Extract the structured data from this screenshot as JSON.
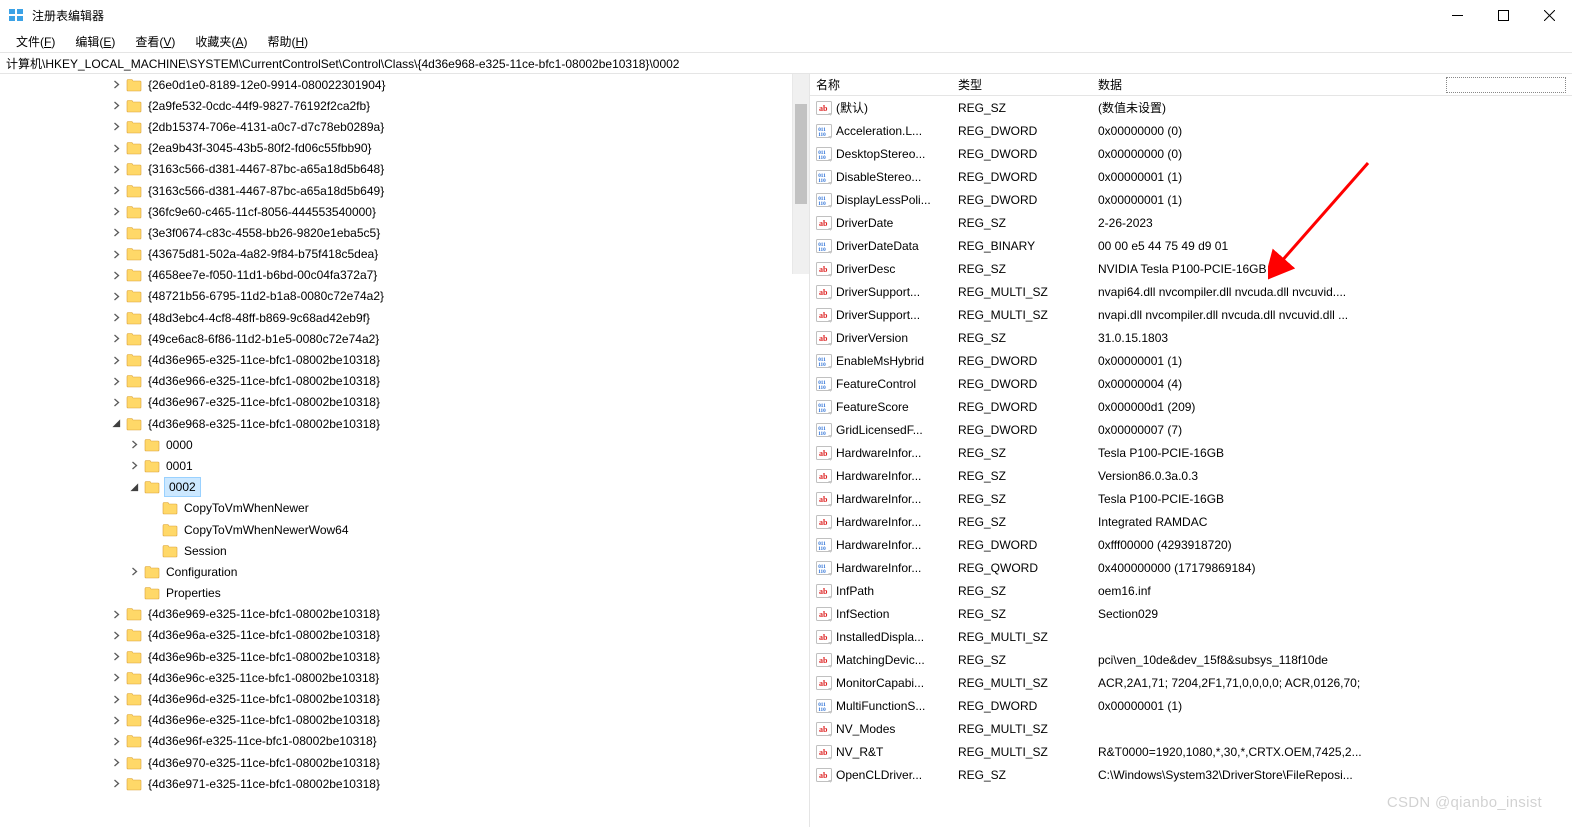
{
  "window": {
    "title": "注册表编辑器"
  },
  "menu": {
    "file": "文件",
    "file_key": "F",
    "edit": "编辑",
    "edit_key": "E",
    "view": "查看",
    "view_key": "V",
    "favorites": "收藏夹",
    "favorites_key": "A",
    "help": "帮助",
    "help_key": "H"
  },
  "address": {
    "path": "计算机\\HKEY_LOCAL_MACHINE\\SYSTEM\\CurrentControlSet\\Control\\Class\\{4d36e968-e325-11ce-bfc1-08002be10318}\\0002"
  },
  "tree": [
    {
      "depth": 0,
      "expander": "closed",
      "label": "{26e0d1e0-8189-12e0-9914-080022301904}"
    },
    {
      "depth": 0,
      "expander": "closed",
      "label": "{2a9fe532-0cdc-44f9-9827-76192f2ca2fb}"
    },
    {
      "depth": 0,
      "expander": "closed",
      "label": "{2db15374-706e-4131-a0c7-d7c78eb0289a}"
    },
    {
      "depth": 0,
      "expander": "closed",
      "label": "{2ea9b43f-3045-43b5-80f2-fd06c55fbb90}"
    },
    {
      "depth": 0,
      "expander": "closed",
      "label": "{3163c566-d381-4467-87bc-a65a18d5b648}"
    },
    {
      "depth": 0,
      "expander": "closed",
      "label": "{3163c566-d381-4467-87bc-a65a18d5b649}"
    },
    {
      "depth": 0,
      "expander": "closed",
      "label": "{36fc9e60-c465-11cf-8056-444553540000}"
    },
    {
      "depth": 0,
      "expander": "closed",
      "label": "{3e3f0674-c83c-4558-bb26-9820e1eba5c5}"
    },
    {
      "depth": 0,
      "expander": "closed",
      "label": "{43675d81-502a-4a82-9f84-b75f418c5dea}"
    },
    {
      "depth": 0,
      "expander": "closed",
      "label": "{4658ee7e-f050-11d1-b6bd-00c04fa372a7}"
    },
    {
      "depth": 0,
      "expander": "closed",
      "label": "{48721b56-6795-11d2-b1a8-0080c72e74a2}"
    },
    {
      "depth": 0,
      "expander": "closed",
      "label": "{48d3ebc4-4cf8-48ff-b869-9c68ad42eb9f}"
    },
    {
      "depth": 0,
      "expander": "closed",
      "label": "{49ce6ac8-6f86-11d2-b1e5-0080c72e74a2}"
    },
    {
      "depth": 0,
      "expander": "closed",
      "label": "{4d36e965-e325-11ce-bfc1-08002be10318}"
    },
    {
      "depth": 0,
      "expander": "closed",
      "label": "{4d36e966-e325-11ce-bfc1-08002be10318}"
    },
    {
      "depth": 0,
      "expander": "closed",
      "label": "{4d36e967-e325-11ce-bfc1-08002be10318}"
    },
    {
      "depth": 0,
      "expander": "open",
      "label": "{4d36e968-e325-11ce-bfc1-08002be10318}"
    },
    {
      "depth": 1,
      "expander": "closed",
      "label": "0000"
    },
    {
      "depth": 1,
      "expander": "closed",
      "label": "0001"
    },
    {
      "depth": 1,
      "expander": "open",
      "label": "0002",
      "selected": true
    },
    {
      "depth": 2,
      "expander": "none",
      "label": "CopyToVmWhenNewer"
    },
    {
      "depth": 2,
      "expander": "none",
      "label": "CopyToVmWhenNewerWow64"
    },
    {
      "depth": 2,
      "expander": "none",
      "label": "Session"
    },
    {
      "depth": 1,
      "expander": "closed",
      "label": "Configuration"
    },
    {
      "depth": 1,
      "expander": "none",
      "label": "Properties"
    },
    {
      "depth": 0,
      "expander": "closed",
      "label": "{4d36e969-e325-11ce-bfc1-08002be10318}"
    },
    {
      "depth": 0,
      "expander": "closed",
      "label": "{4d36e96a-e325-11ce-bfc1-08002be10318}"
    },
    {
      "depth": 0,
      "expander": "closed",
      "label": "{4d36e96b-e325-11ce-bfc1-08002be10318}"
    },
    {
      "depth": 0,
      "expander": "closed",
      "label": "{4d36e96c-e325-11ce-bfc1-08002be10318}"
    },
    {
      "depth": 0,
      "expander": "closed",
      "label": "{4d36e96d-e325-11ce-bfc1-08002be10318}"
    },
    {
      "depth": 0,
      "expander": "closed",
      "label": "{4d36e96e-e325-11ce-bfc1-08002be10318}"
    },
    {
      "depth": 0,
      "expander": "closed",
      "label": "{4d36e96f-e325-11ce-bfc1-08002be10318}"
    },
    {
      "depth": 0,
      "expander": "closed",
      "label": "{4d36e970-e325-11ce-bfc1-08002be10318}"
    },
    {
      "depth": 0,
      "expander": "closed",
      "label": "{4d36e971-e325-11ce-bfc1-08002be10318}"
    }
  ],
  "columns": {
    "name": "名称",
    "type": "类型",
    "data": "数据"
  },
  "values": [
    {
      "icon": "sz",
      "name": "(默认)",
      "type": "REG_SZ",
      "data": "(数值未设置)"
    },
    {
      "icon": "bin",
      "name": "Acceleration.L...",
      "type": "REG_DWORD",
      "data": "0x00000000 (0)"
    },
    {
      "icon": "bin",
      "name": "DesktopStereo...",
      "type": "REG_DWORD",
      "data": "0x00000000 (0)"
    },
    {
      "icon": "bin",
      "name": "DisableStereo...",
      "type": "REG_DWORD",
      "data": "0x00000001 (1)"
    },
    {
      "icon": "bin",
      "name": "DisplayLessPoli...",
      "type": "REG_DWORD",
      "data": "0x00000001 (1)"
    },
    {
      "icon": "sz",
      "name": "DriverDate",
      "type": "REG_SZ",
      "data": "2-26-2023"
    },
    {
      "icon": "bin",
      "name": "DriverDateData",
      "type": "REG_BINARY",
      "data": "00 00 e5 44 75 49 d9 01"
    },
    {
      "icon": "sz",
      "name": "DriverDesc",
      "type": "REG_SZ",
      "data": "NVIDIA Tesla P100-PCIE-16GB"
    },
    {
      "icon": "sz",
      "name": "DriverSupport...",
      "type": "REG_MULTI_SZ",
      "data": "nvapi64.dll nvcompiler.dll nvcuda.dll nvcuvid...."
    },
    {
      "icon": "sz",
      "name": "DriverSupport...",
      "type": "REG_MULTI_SZ",
      "data": "nvapi.dll nvcompiler.dll nvcuda.dll nvcuvid.dll ..."
    },
    {
      "icon": "sz",
      "name": "DriverVersion",
      "type": "REG_SZ",
      "data": "31.0.15.1803"
    },
    {
      "icon": "bin",
      "name": "EnableMsHybrid",
      "type": "REG_DWORD",
      "data": "0x00000001 (1)"
    },
    {
      "icon": "bin",
      "name": "FeatureControl",
      "type": "REG_DWORD",
      "data": "0x00000004 (4)"
    },
    {
      "icon": "bin",
      "name": "FeatureScore",
      "type": "REG_DWORD",
      "data": "0x000000d1 (209)"
    },
    {
      "icon": "bin",
      "name": "GridLicensedF...",
      "type": "REG_DWORD",
      "data": "0x00000007 (7)"
    },
    {
      "icon": "sz",
      "name": "HardwareInfor...",
      "type": "REG_SZ",
      "data": "Tesla P100-PCIE-16GB"
    },
    {
      "icon": "sz",
      "name": "HardwareInfor...",
      "type": "REG_SZ",
      "data": "Version86.0.3a.0.3"
    },
    {
      "icon": "sz",
      "name": "HardwareInfor...",
      "type": "REG_SZ",
      "data": "Tesla P100-PCIE-16GB"
    },
    {
      "icon": "sz",
      "name": "HardwareInfor...",
      "type": "REG_SZ",
      "data": "Integrated RAMDAC"
    },
    {
      "icon": "bin",
      "name": "HardwareInfor...",
      "type": "REG_DWORD",
      "data": "0xfff00000 (4293918720)"
    },
    {
      "icon": "bin",
      "name": "HardwareInfor...",
      "type": "REG_QWORD",
      "data": "0x400000000 (17179869184)"
    },
    {
      "icon": "sz",
      "name": "InfPath",
      "type": "REG_SZ",
      "data": "oem16.inf"
    },
    {
      "icon": "sz",
      "name": "InfSection",
      "type": "REG_SZ",
      "data": "Section029"
    },
    {
      "icon": "sz",
      "name": "InstalledDispla...",
      "type": "REG_MULTI_SZ",
      "data": ""
    },
    {
      "icon": "sz",
      "name": "MatchingDevic...",
      "type": "REG_SZ",
      "data": "pci\\ven_10de&dev_15f8&subsys_118f10de"
    },
    {
      "icon": "sz",
      "name": "MonitorCapabi...",
      "type": "REG_MULTI_SZ",
      "data": "ACR,2A1,71; 7204,2F1,71,0,0,0,0; ACR,0126,70;"
    },
    {
      "icon": "bin",
      "name": "MultiFunctionS...",
      "type": "REG_DWORD",
      "data": "0x00000001 (1)"
    },
    {
      "icon": "sz",
      "name": "NV_Modes",
      "type": "REG_MULTI_SZ",
      "data": ""
    },
    {
      "icon": "sz",
      "name": "NV_R&T",
      "type": "REG_MULTI_SZ",
      "data": "R&T0000=1920,1080,*,30,*,CRTX.OEM,7425,2..."
    },
    {
      "icon": "sz",
      "name": "OpenCLDriver...",
      "type": "REG_SZ",
      "data": "C:\\Windows\\System32\\DriverStore\\FileReposi..."
    }
  ],
  "watermark": "CSDN @qianbo_insist"
}
